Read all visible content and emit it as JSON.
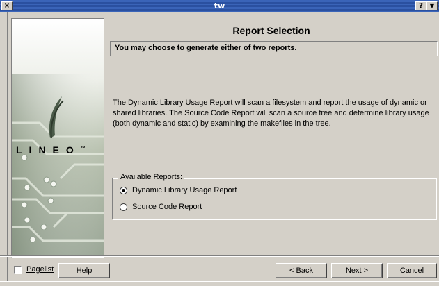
{
  "window": {
    "title": "tw",
    "close_glyph": "×",
    "help_glyph": "?",
    "menu_glyph": "▼"
  },
  "sidebar": {
    "logo_text": "LINEO",
    "logo_tm": "™"
  },
  "page": {
    "title": "Report Selection",
    "subtitle": "You may choose to generate either of two reports.",
    "description": "The Dynamic Library Usage Report will scan a filesystem and report the usage of dynamic or shared libraries. The Source Code Report will scan a source tree and determine library usage (both dynamic and static) by examining the makefiles in the tree."
  },
  "reports": {
    "group_label": "Available Reports:",
    "options": [
      {
        "label": "Dynamic Library Usage Report",
        "selected": true
      },
      {
        "label": "Source Code Report",
        "selected": false
      }
    ]
  },
  "footer": {
    "pagelist_label": "Pagelist",
    "pagelist_checked": false,
    "help_label": "Help",
    "back_label": "< Back",
    "next_label": "Next >",
    "cancel_label": "Cancel"
  }
}
